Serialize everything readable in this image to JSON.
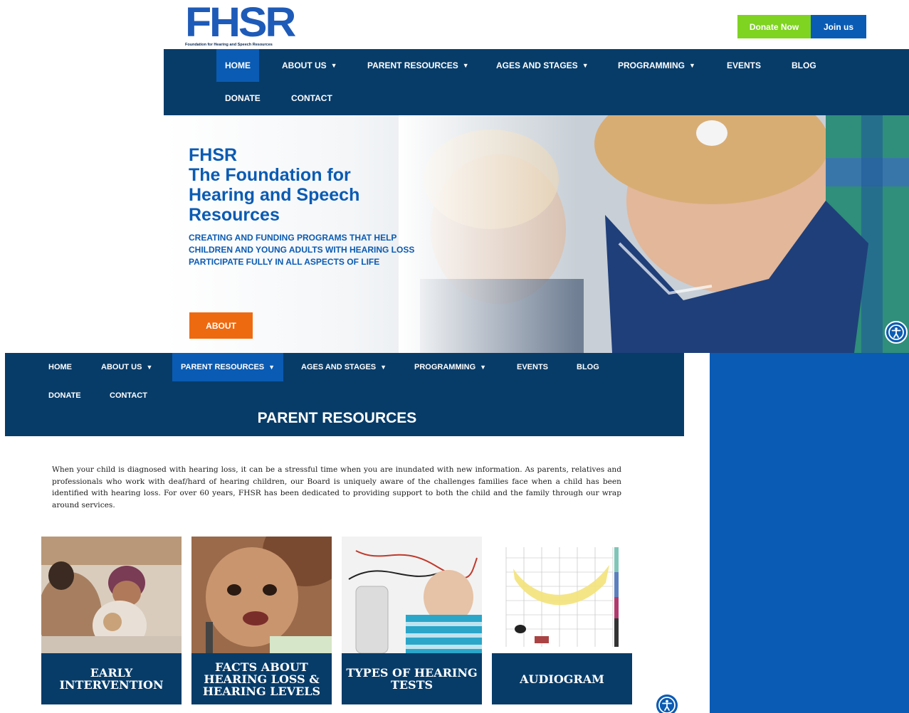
{
  "top": {
    "logo": {
      "text": "FHSR",
      "subtitle": "Foundation for Hearing and Speech Resources"
    },
    "buttons": {
      "donate": "Donate Now",
      "join": "Join us"
    },
    "nav": {
      "home": "HOME",
      "about": "ABOUT US",
      "parent": "PARENT RESOURCES",
      "ages": "AGES AND STAGES",
      "programming": "PROGRAMMING",
      "events": "EVENTS",
      "blog": "BLOG",
      "donate": "DONATE",
      "contact": "CONTACT",
      "active": "HOME"
    },
    "hero": {
      "title_line1": "FHSR",
      "title_line2": "The Foundation for",
      "title_line3": "Hearing and Speech",
      "title_line4": "Resources",
      "sub_line1": "CREATING AND FUNDING PROGRAMS THAT HELP",
      "sub_line2": "CHILDREN AND YOUNG ADULTS WITH HEARING LOSS",
      "sub_line3": "PARTICIPATE FULLY IN ALL ASPECTS OF LIFE",
      "button": "ABOUT"
    }
  },
  "bottom": {
    "nav": {
      "home": "HOME",
      "about": "ABOUT US",
      "parent": "PARENT RESOURCES",
      "ages": "AGES AND STAGES",
      "programming": "PROGRAMMING",
      "events": "EVENTS",
      "blog": "BLOG",
      "donate": "DONATE",
      "contact": "CONTACT",
      "active": "PARENT RESOURCES"
    },
    "heading": "PARENT RESOURCES",
    "intro": "When your child is diagnosed with hearing loss, it can be a stressful time when you are inundated with new information. As parents, relatives and professionals who work with deaf/hard of hearing children, our Board is uniquely aware of the challenges families face when a child has been identified with hearing loss. For over 60 years, FHSR has been dedicated to providing support to both the child and the family through our wrap around services.",
    "cards": [
      {
        "line1": "EARLY",
        "line2": "INTERVENTION",
        "line3": ""
      },
      {
        "line1": "FACTS ABOUT",
        "line2": "HEARING LOSS &",
        "line3": "HEARING LEVELS"
      },
      {
        "line1": "TYPES OF HEARING",
        "line2": "TESTS",
        "line3": ""
      },
      {
        "line1": "AUDIOGRAM",
        "line2": "",
        "line3": ""
      }
    ]
  },
  "colors": {
    "navy": "#073c69",
    "blue": "#0a5bb3",
    "green": "#7fd321",
    "orange": "#ee6a10"
  },
  "icons": {
    "accessibility": "accessibility-icon",
    "caret": "caret-down-icon"
  }
}
